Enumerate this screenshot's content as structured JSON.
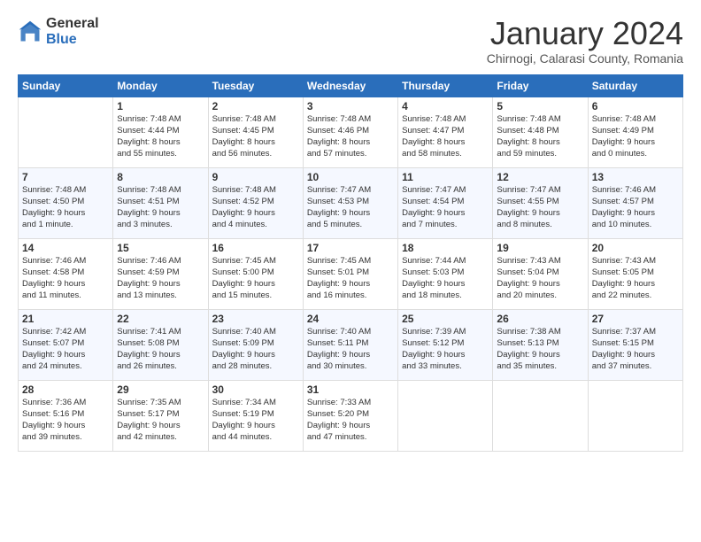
{
  "logo": {
    "general": "General",
    "blue": "Blue"
  },
  "header": {
    "title": "January 2024",
    "subtitle": "Chirnogi, Calarasi County, Romania"
  },
  "days": [
    "Sunday",
    "Monday",
    "Tuesday",
    "Wednesday",
    "Thursday",
    "Friday",
    "Saturday"
  ],
  "weeks": [
    [
      {
        "num": "",
        "content": ""
      },
      {
        "num": "1",
        "content": "Sunrise: 7:48 AM\nSunset: 4:44 PM\nDaylight: 8 hours\nand 55 minutes."
      },
      {
        "num": "2",
        "content": "Sunrise: 7:48 AM\nSunset: 4:45 PM\nDaylight: 8 hours\nand 56 minutes."
      },
      {
        "num": "3",
        "content": "Sunrise: 7:48 AM\nSunset: 4:46 PM\nDaylight: 8 hours\nand 57 minutes."
      },
      {
        "num": "4",
        "content": "Sunrise: 7:48 AM\nSunset: 4:47 PM\nDaylight: 8 hours\nand 58 minutes."
      },
      {
        "num": "5",
        "content": "Sunrise: 7:48 AM\nSunset: 4:48 PM\nDaylight: 8 hours\nand 59 minutes."
      },
      {
        "num": "6",
        "content": "Sunrise: 7:48 AM\nSunset: 4:49 PM\nDaylight: 9 hours\nand 0 minutes."
      }
    ],
    [
      {
        "num": "7",
        "content": "Sunrise: 7:48 AM\nSunset: 4:50 PM\nDaylight: 9 hours\nand 1 minute."
      },
      {
        "num": "8",
        "content": "Sunrise: 7:48 AM\nSunset: 4:51 PM\nDaylight: 9 hours\nand 3 minutes."
      },
      {
        "num": "9",
        "content": "Sunrise: 7:48 AM\nSunset: 4:52 PM\nDaylight: 9 hours\nand 4 minutes."
      },
      {
        "num": "10",
        "content": "Sunrise: 7:47 AM\nSunset: 4:53 PM\nDaylight: 9 hours\nand 5 minutes."
      },
      {
        "num": "11",
        "content": "Sunrise: 7:47 AM\nSunset: 4:54 PM\nDaylight: 9 hours\nand 7 minutes."
      },
      {
        "num": "12",
        "content": "Sunrise: 7:47 AM\nSunset: 4:55 PM\nDaylight: 9 hours\nand 8 minutes."
      },
      {
        "num": "13",
        "content": "Sunrise: 7:46 AM\nSunset: 4:57 PM\nDaylight: 9 hours\nand 10 minutes."
      }
    ],
    [
      {
        "num": "14",
        "content": "Sunrise: 7:46 AM\nSunset: 4:58 PM\nDaylight: 9 hours\nand 11 minutes."
      },
      {
        "num": "15",
        "content": "Sunrise: 7:46 AM\nSunset: 4:59 PM\nDaylight: 9 hours\nand 13 minutes."
      },
      {
        "num": "16",
        "content": "Sunrise: 7:45 AM\nSunset: 5:00 PM\nDaylight: 9 hours\nand 15 minutes."
      },
      {
        "num": "17",
        "content": "Sunrise: 7:45 AM\nSunset: 5:01 PM\nDaylight: 9 hours\nand 16 minutes."
      },
      {
        "num": "18",
        "content": "Sunrise: 7:44 AM\nSunset: 5:03 PM\nDaylight: 9 hours\nand 18 minutes."
      },
      {
        "num": "19",
        "content": "Sunrise: 7:43 AM\nSunset: 5:04 PM\nDaylight: 9 hours\nand 20 minutes."
      },
      {
        "num": "20",
        "content": "Sunrise: 7:43 AM\nSunset: 5:05 PM\nDaylight: 9 hours\nand 22 minutes."
      }
    ],
    [
      {
        "num": "21",
        "content": "Sunrise: 7:42 AM\nSunset: 5:07 PM\nDaylight: 9 hours\nand 24 minutes."
      },
      {
        "num": "22",
        "content": "Sunrise: 7:41 AM\nSunset: 5:08 PM\nDaylight: 9 hours\nand 26 minutes."
      },
      {
        "num": "23",
        "content": "Sunrise: 7:40 AM\nSunset: 5:09 PM\nDaylight: 9 hours\nand 28 minutes."
      },
      {
        "num": "24",
        "content": "Sunrise: 7:40 AM\nSunset: 5:11 PM\nDaylight: 9 hours\nand 30 minutes."
      },
      {
        "num": "25",
        "content": "Sunrise: 7:39 AM\nSunset: 5:12 PM\nDaylight: 9 hours\nand 33 minutes."
      },
      {
        "num": "26",
        "content": "Sunrise: 7:38 AM\nSunset: 5:13 PM\nDaylight: 9 hours\nand 35 minutes."
      },
      {
        "num": "27",
        "content": "Sunrise: 7:37 AM\nSunset: 5:15 PM\nDaylight: 9 hours\nand 37 minutes."
      }
    ],
    [
      {
        "num": "28",
        "content": "Sunrise: 7:36 AM\nSunset: 5:16 PM\nDaylight: 9 hours\nand 39 minutes."
      },
      {
        "num": "29",
        "content": "Sunrise: 7:35 AM\nSunset: 5:17 PM\nDaylight: 9 hours\nand 42 minutes."
      },
      {
        "num": "30",
        "content": "Sunrise: 7:34 AM\nSunset: 5:19 PM\nDaylight: 9 hours\nand 44 minutes."
      },
      {
        "num": "31",
        "content": "Sunrise: 7:33 AM\nSunset: 5:20 PM\nDaylight: 9 hours\nand 47 minutes."
      },
      {
        "num": "",
        "content": ""
      },
      {
        "num": "",
        "content": ""
      },
      {
        "num": "",
        "content": ""
      }
    ]
  ]
}
